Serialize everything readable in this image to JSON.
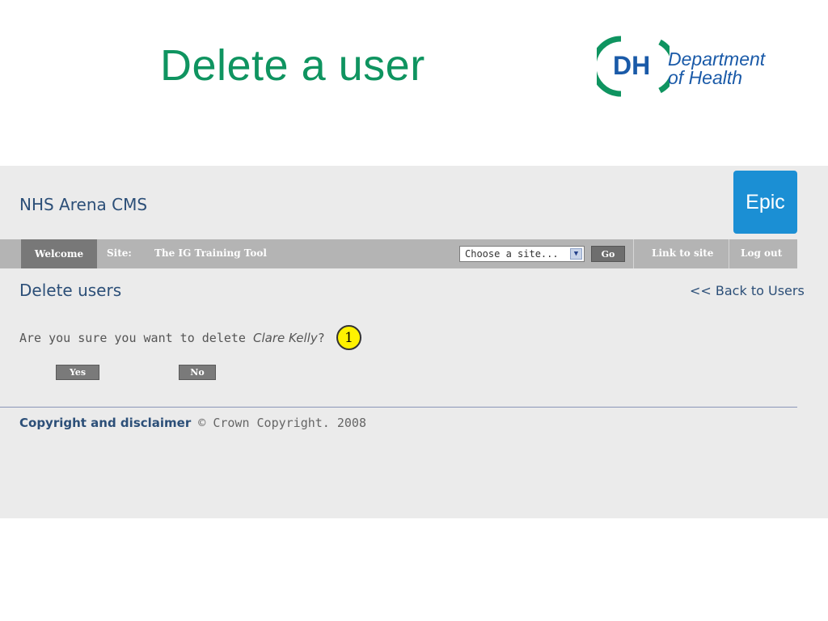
{
  "slide": {
    "title": "Delete a user",
    "logo": {
      "initials": "DH",
      "line1": "Department",
      "line2": "of Health"
    }
  },
  "cms": {
    "title": "NHS Arena CMS",
    "badge": "Epic"
  },
  "nav": {
    "welcome": "Welcome",
    "site_label": "Site:",
    "site_name": "The IG Training Tool",
    "select_value": "Choose a site...",
    "go_label": "Go",
    "link_to_site": "Link to site",
    "log_out": "Log out"
  },
  "content": {
    "heading": "Delete users",
    "back_link": "<< Back to Users",
    "confirm_prefix": "Are you sure you want to delete ",
    "user_name": "Clare Kelly",
    "confirm_suffix": "?",
    "callout_number": "1",
    "yes_label": "Yes",
    "no_label": "No"
  },
  "footer": {
    "link": "Copyright and disclaimer",
    "text": " © Crown Copyright. 2008"
  },
  "colors": {
    "title_green": "#0f9460",
    "dh_blue": "#1a5aa8",
    "epic_blue": "#1b8fd4",
    "nav_grey": "#b4b4b4",
    "heading_navy": "#2c4f78",
    "callout_yellow": "#fff200"
  }
}
